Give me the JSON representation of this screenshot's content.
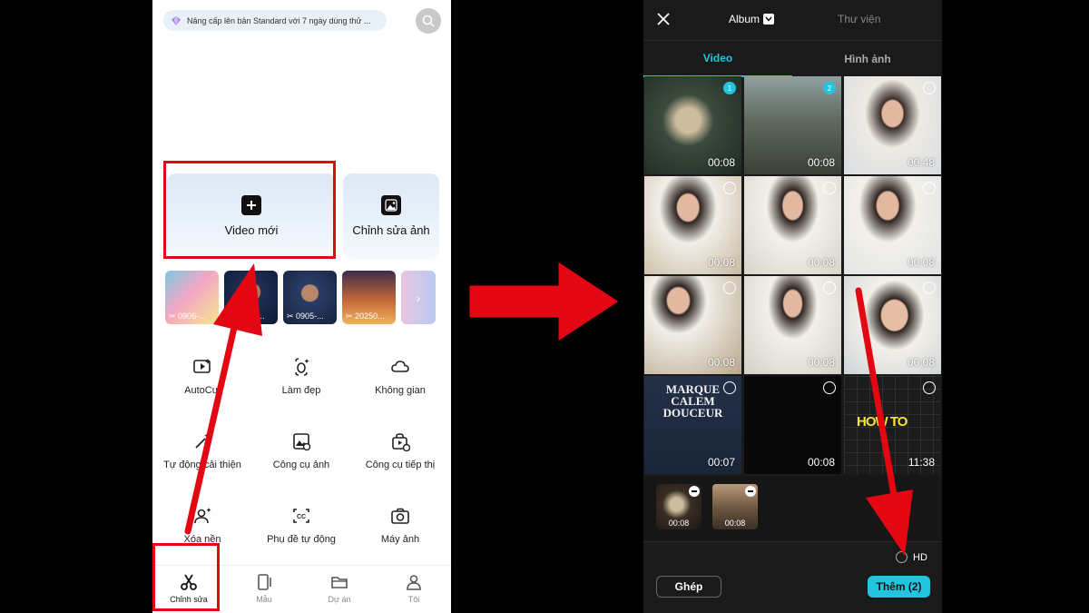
{
  "colors": {
    "accent": "#22c5e0",
    "highlight_red": "#e30613"
  },
  "left": {
    "upgrade_banner": "Nâng cấp lên bản Standard với 7 ngày dùng thử ...",
    "new_video": "Video mới",
    "edit_photo": "Chỉnh sửa ảnh",
    "recent": [
      {
        "label": "0906-..."
      },
      {
        "label": "0905-..."
      },
      {
        "label": "0905-..."
      },
      {
        "label": "20250..."
      }
    ],
    "tools": [
      {
        "label": "AutoCut",
        "icon": "autocut-icon"
      },
      {
        "label": "Làm đẹp",
        "icon": "beauty-icon"
      },
      {
        "label": "Không gian",
        "icon": "cloud-icon"
      },
      {
        "label": "Tự động cải thiện",
        "icon": "magic-wand-icon"
      },
      {
        "label": "Công cụ ảnh",
        "icon": "photo-tool-icon"
      },
      {
        "label": "Công cụ tiếp thị",
        "icon": "marketing-icon"
      },
      {
        "label": "Xóa nền",
        "icon": "remove-bg-icon"
      },
      {
        "label": "Phụ đề tự động",
        "icon": "caption-icon"
      },
      {
        "label": "Máy ảnh",
        "icon": "camera-icon"
      }
    ],
    "nav": [
      {
        "label": "Chỉnh sửa",
        "icon": "scissors-icon"
      },
      {
        "label": "Mẫu",
        "icon": "template-icon"
      },
      {
        "label": "Dự án",
        "icon": "folder-icon"
      },
      {
        "label": "Tôi",
        "icon": "profile-icon"
      }
    ]
  },
  "right": {
    "album_tab": "Album",
    "library_tab": "Thư viện",
    "media_tabs": {
      "video": "Video",
      "photo": "Hình ảnh"
    },
    "grid": [
      {
        "duration": "00:08",
        "selected": "1"
      },
      {
        "duration": "00:08",
        "selected": "2"
      },
      {
        "duration": "00:48",
        "selected": ""
      },
      {
        "duration": "00:08",
        "selected": ""
      },
      {
        "duration": "00:08",
        "selected": ""
      },
      {
        "duration": "00:08",
        "selected": ""
      },
      {
        "duration": "00:08",
        "selected": ""
      },
      {
        "duration": "00:08",
        "selected": ""
      },
      {
        "duration": "00:08",
        "selected": ""
      },
      {
        "duration": "00:07",
        "selected": "",
        "overlay": [
          "MARQUE",
          "CALEM",
          "DOUCEUR"
        ]
      },
      {
        "duration": "00:08",
        "selected": ""
      },
      {
        "duration": "11:38",
        "selected": "",
        "overlay": [
          "HOW TO"
        ]
      }
    ],
    "selected_items": [
      {
        "duration": "00:08"
      },
      {
        "duration": "00:08"
      }
    ],
    "hd_label": "HD",
    "merge_btn": "Ghép",
    "add_btn": "Thêm (2)"
  }
}
